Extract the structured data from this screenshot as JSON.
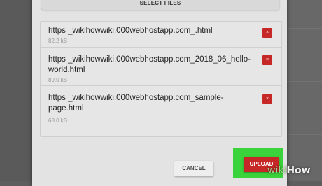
{
  "dialog": {
    "select_files_label": "SELECT FILES",
    "files": [
      {
        "name": "https _wikihowwiki.000webhostapp.com_.html",
        "size": "82.2 kB"
      },
      {
        "name": "https _wikihowwiki.000webhostapp.com_2018_06_hello-world.html",
        "size": "89.0 kB"
      },
      {
        "name": "https _wikihowwiki.000webhostapp.com_sample-page.html",
        "size": "68.0 kB"
      }
    ],
    "delete_label": "×",
    "cancel_label": "CANCEL",
    "upload_label": "UPLOAD"
  },
  "watermark": {
    "wiki": "wiki",
    "how": "How"
  },
  "colors": {
    "accent_red": "#c62828",
    "highlight_green": "#3bd33b",
    "dialog_bg": "#e3e3e3"
  }
}
